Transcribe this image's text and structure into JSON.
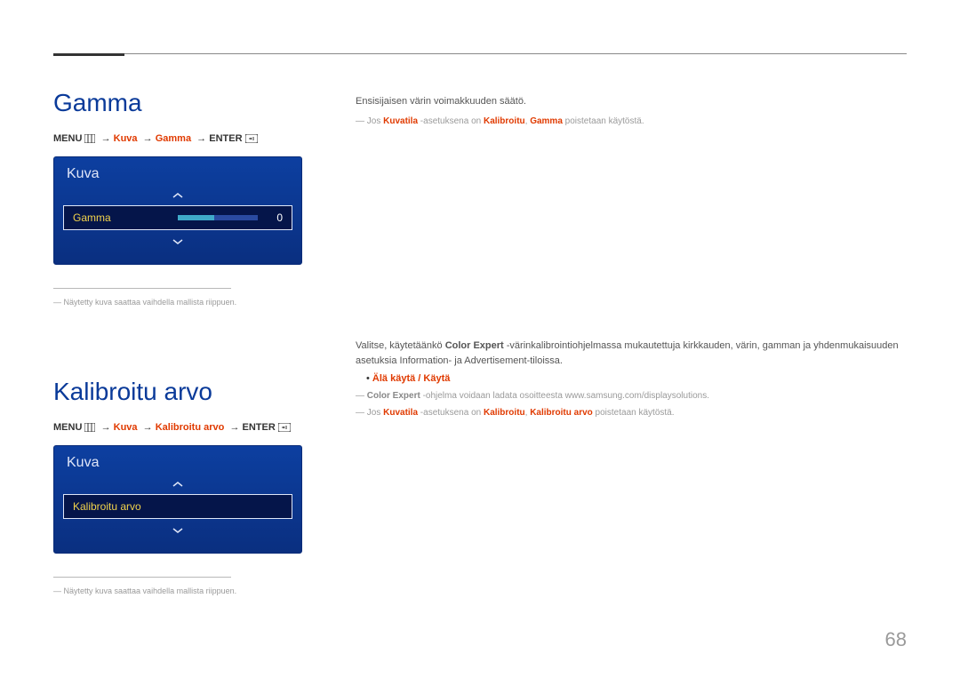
{
  "page_number": "68",
  "section1": {
    "heading": "Gamma",
    "crumb": {
      "menu": "MENU",
      "kuva": "Kuva",
      "gamma": "Gamma",
      "enter": "ENTER"
    },
    "panel": {
      "title": "Kuva",
      "row_label": "Gamma",
      "row_value": "0"
    },
    "footnote": "Näytetty kuva saattaa vaihdella mallista riippuen.",
    "body1": "Ensisijaisen värin voimakkuuden säätö.",
    "note1_pre": "Jos ",
    "note1_em1": "Kuvatila",
    "note1_mid1": " -asetuksena on ",
    "note1_em2": "Kalibroitu",
    "note1_mid2": ", ",
    "note1_em3": "Gamma",
    "note1_tail": " poistetaan käytöstä."
  },
  "section2": {
    "heading": "Kalibroitu arvo",
    "crumb": {
      "menu": "MENU",
      "kuva": "Kuva",
      "kalib": "Kalibroitu arvo",
      "enter": "ENTER"
    },
    "panel": {
      "title": "Kuva",
      "row_label": "Kalibroitu arvo"
    },
    "footnote": "Näytetty kuva saattaa vaihdella mallista riippuen.",
    "body1_pre": "Valitse, käytetäänkö ",
    "body1_bold": "Color Expert",
    "body1_post": " -värinkalibrointiohjelmassa mukautettuja kirkkauden, värin, gamman ja yhdenmukaisuuden asetuksia Information- ja Advertisement-tiloissa.",
    "bullet_options": "Älä käytä / Käytä",
    "note2_pre": "",
    "note2_bold": "Color Expert",
    "note2_post": " -ohjelma voidaan ladata osoitteesta www.samsung.com/displaysolutions.",
    "note3_pre": "Jos ",
    "note3_em1": "Kuvatila",
    "note3_mid1": " -asetuksena on ",
    "note3_em2": "Kalibroitu",
    "note3_mid2": ", ",
    "note3_em3": "Kalibroitu arvo",
    "note3_tail": " poistetaan käytöstä."
  }
}
